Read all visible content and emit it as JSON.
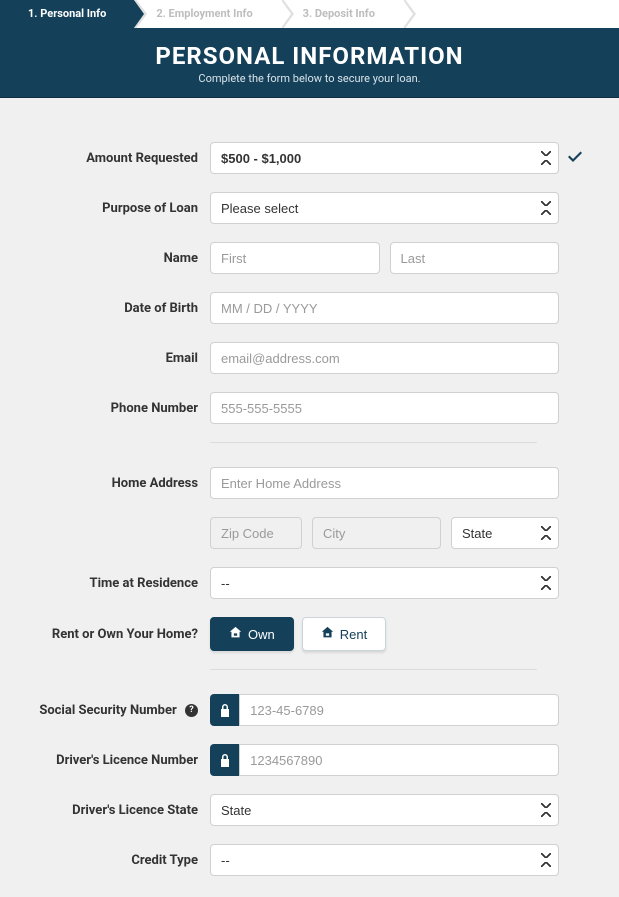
{
  "steps": [
    {
      "label": "1. Personal Info",
      "active": true
    },
    {
      "label": "2. Employment Info",
      "active": false
    },
    {
      "label": "3. Deposit Info",
      "active": false
    }
  ],
  "header": {
    "title": "PERSONAL INFORMATION",
    "subtitle": "Complete the form below to secure your loan."
  },
  "form": {
    "amount_requested": {
      "label": "Amount Requested",
      "value": "$500 - $1,000",
      "validated": true
    },
    "purpose": {
      "label": "Purpose of Loan",
      "value": "Please select"
    },
    "name": {
      "label": "Name",
      "first_placeholder": "First",
      "last_placeholder": "Last"
    },
    "dob": {
      "label": "Date of Birth",
      "placeholder": "MM / DD / YYYY"
    },
    "email": {
      "label": "Email",
      "placeholder": "email@address.com"
    },
    "phone": {
      "label": "Phone Number",
      "placeholder": "555-555-5555"
    },
    "address": {
      "label": "Home Address",
      "placeholder": "Enter Home Address"
    },
    "zip": {
      "placeholder": "Zip Code"
    },
    "city": {
      "placeholder": "City"
    },
    "state": {
      "value": "State"
    },
    "time_residence": {
      "label": "Time at Residence",
      "value": "--"
    },
    "rent_own": {
      "label": "Rent or Own Your Home?",
      "own": "Own",
      "rent": "Rent",
      "selected": "own"
    },
    "ssn": {
      "label": "Social Security Number",
      "placeholder": "123-45-6789",
      "help": "?"
    },
    "dl_number": {
      "label": "Driver's Licence Number",
      "placeholder": "1234567890"
    },
    "dl_state": {
      "label": "Driver's Licence State",
      "value": "State"
    },
    "credit_type": {
      "label": "Credit Type",
      "value": "--"
    }
  }
}
